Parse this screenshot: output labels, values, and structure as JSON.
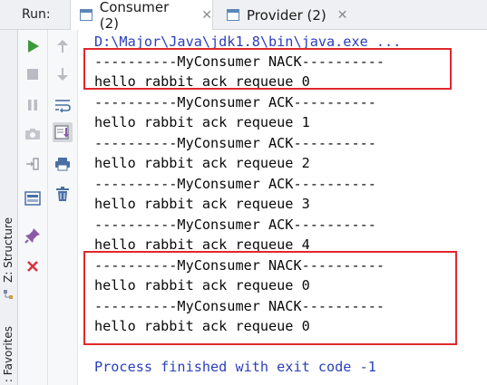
{
  "run_bar": {
    "label": "Run:",
    "tabs": [
      {
        "label": "Consumer (2)",
        "close": "✕",
        "active": true
      },
      {
        "label": "Provider (2)",
        "close": "✕",
        "active": false
      }
    ]
  },
  "side_panels": {
    "structure": "Z: Structure",
    "favorites": ": Favorites"
  },
  "toolbar_left": [
    "run-icon",
    "stop-icon",
    "pause-icon",
    "camera-icon",
    "login-icon",
    "layout-icon",
    "pin-icon",
    "close-icon"
  ],
  "toolbar_right": [
    "up-arrow-icon",
    "down-arrow-icon",
    "soft-wrap-icon",
    "scroll-to-end-icon",
    "print-icon",
    "trash-icon"
  ],
  "console": {
    "command": "D:\\Major\\Java\\jdk1.8\\bin\\java.exe ...",
    "lines": [
      "----------MyConsumer NACK----------",
      "hello rabbit ack requeue 0",
      "----------MyConsumer ACK----------",
      "hello rabbit ack requeue 1",
      "----------MyConsumer ACK----------",
      "hello rabbit ack requeue 2",
      "----------MyConsumer ACK----------",
      "hello rabbit ack requeue 3",
      "----------MyConsumer ACK----------",
      "hello rabbit ack requeue 4",
      "----------MyConsumer NACK----------",
      "hello rabbit ack requeue 0",
      "----------MyConsumer NACK----------",
      "hello rabbit ack requeue 0"
    ],
    "exit_message": "Process finished with exit code -1"
  },
  "colors": {
    "highlight": "#e0282c",
    "run_green": "#3a9a3a",
    "console_blue": "#2a3fbd"
  }
}
